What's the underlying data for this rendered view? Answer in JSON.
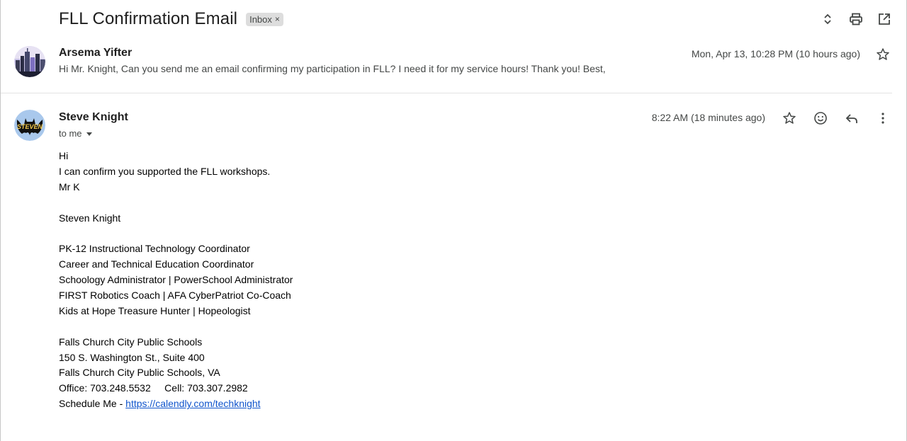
{
  "thread": {
    "subject": "FLL Confirmation Email",
    "label": "Inbox",
    "label_remove": "×"
  },
  "toolbar": {
    "icons": [
      "expand-collapse-icon",
      "print-icon",
      "open-in-new-window-icon"
    ]
  },
  "messages": [
    {
      "sender": "Arsema Yifter",
      "date": "Mon, Apr 13, 10:28 PM (10 hours ago)",
      "snippet": "Hi Mr. Knight, Can you send me an email confirming my participation in FLL? I need it for my service hours! Thank you! Best,"
    },
    {
      "sender": "Steve Knight",
      "recipient": "to me",
      "date": "8:22 AM (18 minutes ago)",
      "body": {
        "greeting": "Hi",
        "line1": "I can confirm you supported the FLL workshops.",
        "signoff": "Mr K",
        "name": "Steven Knight",
        "title1": "PK-12 Instructional Technology Coordinator",
        "title2": "Career and Technical Education Coordinator",
        "title3": "Schoology Administrator | PowerSchool Administrator",
        "title4": "FIRST Robotics Coach | AFA CyberPatriot Co-Coach",
        "title5": "Kids at Hope Treasure Hunter | Hopeologist",
        "org": "Falls Church City Public Schools",
        "address": "150 S. Washington St., Suite 400",
        "city": "Falls Church City Public Schools, VA",
        "phones": "Office: 703.248.5532     Cell: 703.307.2982",
        "schedule_prefix": "Schedule Me - ",
        "schedule_link": "https://calendly.com/techknight"
      },
      "avatar_text": "STEVEN"
    }
  ],
  "colors": {
    "link": "#1155cc",
    "chip_bg": "#dddddd",
    "divider": "#e3e3e3"
  }
}
